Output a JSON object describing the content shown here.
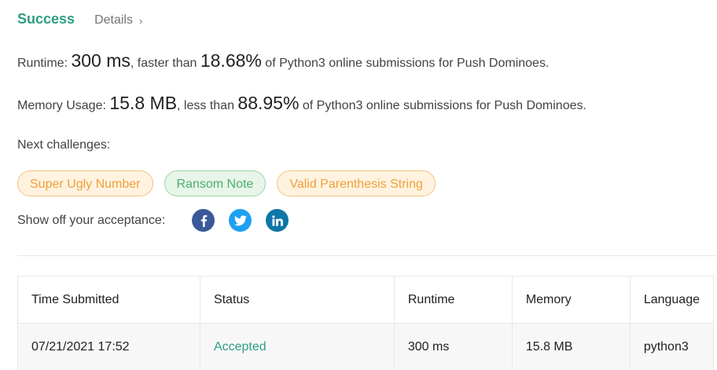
{
  "header": {
    "status": "Success",
    "details_label": "Details",
    "chevron": "›"
  },
  "runtime_stat": {
    "label": "Runtime: ",
    "value": "300 ms",
    "comparison": ", faster than ",
    "percent": "18.68%",
    "suffix": " of Python3 online submissions for Push Dominoes."
  },
  "memory_stat": {
    "label": "Memory Usage: ",
    "value": "15.8 MB",
    "comparison": ", less than ",
    "percent": "88.95%",
    "suffix": " of Python3 online submissions for Push Dominoes."
  },
  "next_challenges": {
    "label": "Next challenges:",
    "items": [
      {
        "label": "Super Ugly Number",
        "difficulty": "medium"
      },
      {
        "label": "Ransom Note",
        "difficulty": "easy"
      },
      {
        "label": "Valid Parenthesis String",
        "difficulty": "medium"
      }
    ]
  },
  "share": {
    "label": "Show off your acceptance:",
    "icons": [
      "facebook-icon",
      "twitter-icon",
      "linkedin-icon"
    ]
  },
  "submissions": {
    "columns": [
      "Time Submitted",
      "Status",
      "Runtime",
      "Memory",
      "Language"
    ],
    "rows": [
      [
        "07/21/2021 17:52",
        "Accepted",
        "300 ms",
        "15.8 MB",
        "python3"
      ]
    ]
  },
  "colors": {
    "accent": "#2e9e83",
    "medium_chip": "#f0a03a",
    "easy_chip": "#4caf6a",
    "facebook": "#3b5998",
    "twitter": "#1da1f2",
    "linkedin": "#0e76a8"
  }
}
